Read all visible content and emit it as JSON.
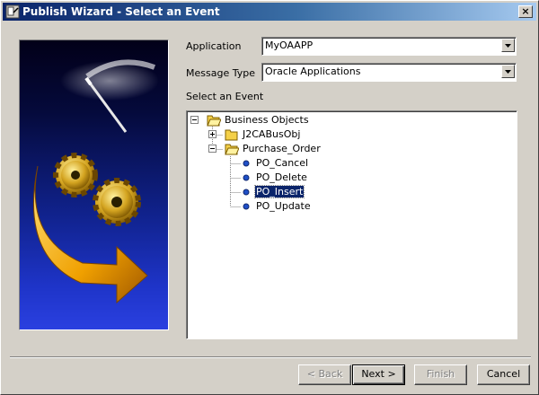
{
  "window": {
    "title": "Publish Wizard - Select an Event",
    "close_glyph": "×"
  },
  "form": {
    "application_label": "Application",
    "application_value": "MyOAAPP",
    "message_type_label": "Message Type",
    "message_type_value": "Oracle Applications",
    "event_label": "Select an Event"
  },
  "tree": {
    "root": "Business Objects",
    "folder1": "J2CABusObj",
    "folder2": "Purchase_Order",
    "events": [
      "PO_Cancel",
      "PO_Delete",
      "PO_Insert",
      "PO_Update"
    ],
    "selected": "PO_Insert"
  },
  "buttons": {
    "back": "< Back",
    "next": "Next >",
    "finish": "Finish",
    "cancel": "Cancel"
  },
  "colors": {
    "selection": "#0a246a",
    "title_start": "#0a246a",
    "title_end": "#a6caf0",
    "banner_top": "#020018",
    "banner_bottom": "#2a40e0",
    "arrow": "#f0a000",
    "folder": "#f4d048",
    "event_dot": "#2050c8"
  }
}
